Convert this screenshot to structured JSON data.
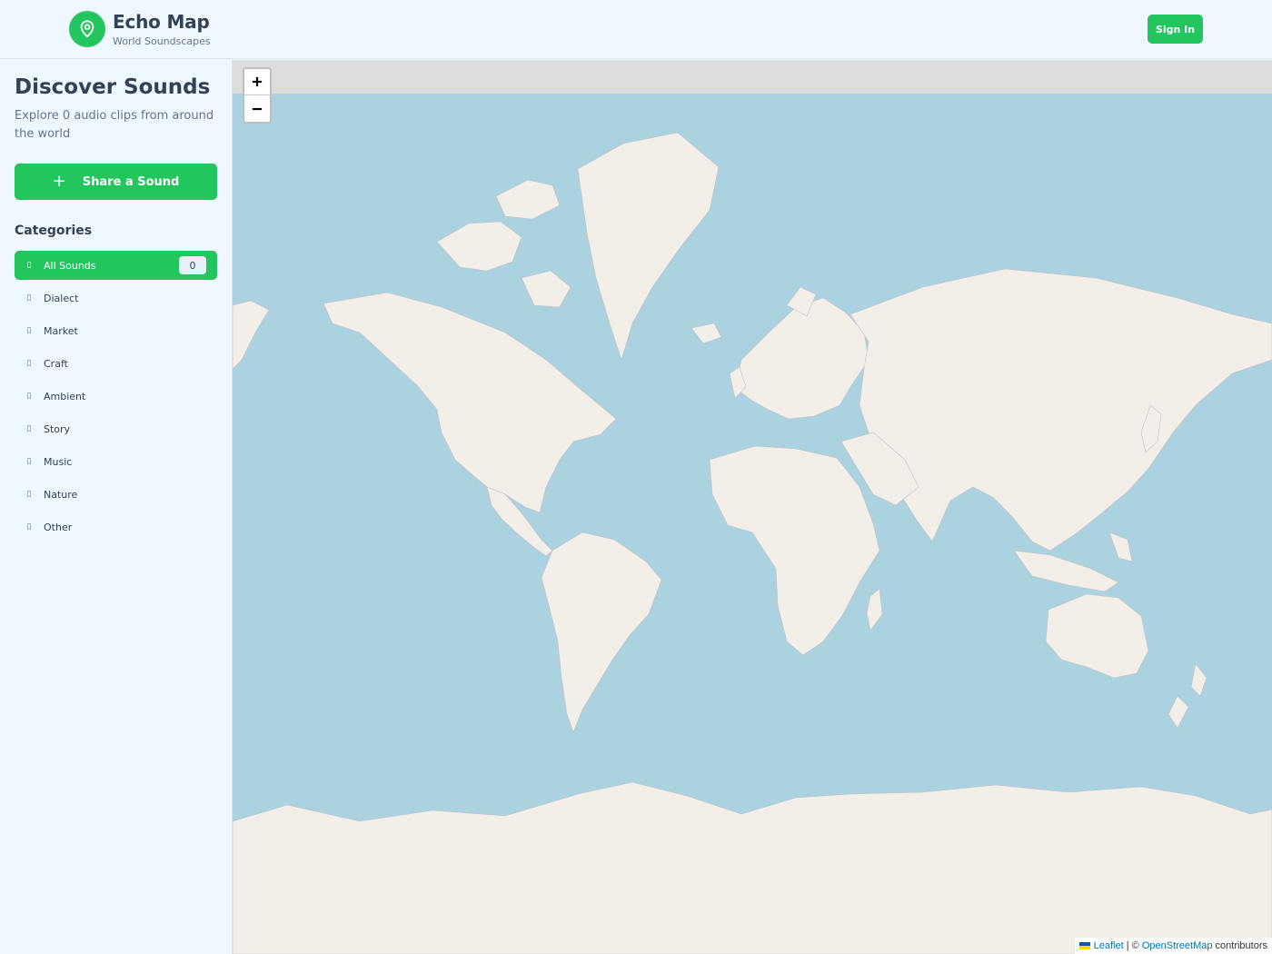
{
  "header": {
    "brand_title": "Echo Map",
    "brand_subtitle": "World Soundscapes",
    "logo_icon": "map-pin-icon",
    "signin_label": "Sign In"
  },
  "sidebar": {
    "title": "Discover Sounds",
    "description": "Explore 0 audio clips from around the world",
    "share_label": "Share a Sound",
    "categories_heading": "Categories",
    "categories": [
      {
        "label": "All Sounds",
        "count": "0",
        "active": true
      },
      {
        "label": "Dialect"
      },
      {
        "label": "Market"
      },
      {
        "label": "Craft"
      },
      {
        "label": "Ambient"
      },
      {
        "label": "Story"
      },
      {
        "label": "Music"
      },
      {
        "label": "Nature"
      },
      {
        "label": "Other"
      }
    ]
  },
  "map": {
    "zoom_in": "+",
    "zoom_out": "−",
    "attribution_leaflet": "Leaflet",
    "attribution_sep": " | © ",
    "attribution_osm": "OpenStreetMap",
    "attribution_suffix": " contributors",
    "ocean_color": "#aad3df",
    "land_color": "#f2efe9"
  },
  "colors": {
    "accent": "#22c55e",
    "text": "#334155",
    "muted": "#64748b"
  }
}
